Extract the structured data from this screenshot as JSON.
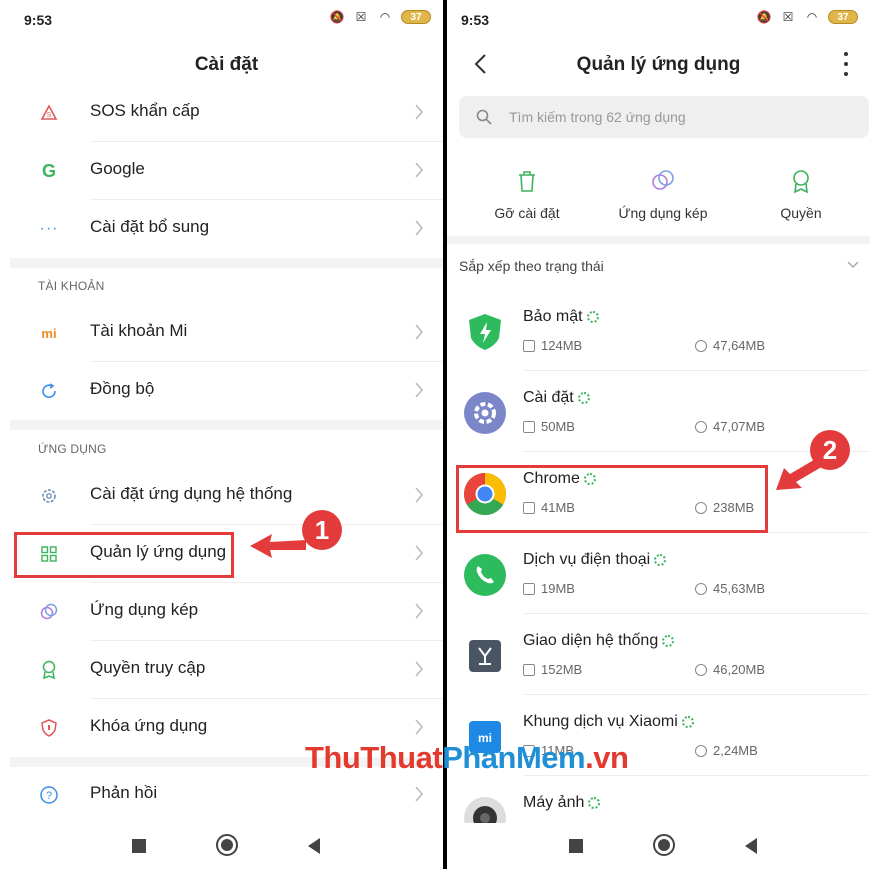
{
  "left": {
    "status": {
      "time": "9:53",
      "battery": "37"
    },
    "title": "Cài đặt",
    "rows_top": [
      {
        "label": "SOS khẩn cấp",
        "icon": "sos-icon"
      },
      {
        "label": "Google",
        "icon": "google-icon"
      },
      {
        "label": "Cài đặt bổ sung",
        "icon": "more-dots-icon"
      }
    ],
    "section_account": "TÀI KHOẢN",
    "rows_account": [
      {
        "label": "Tài khoản Mi",
        "icon": "mi-icon"
      },
      {
        "label": "Đồng bộ",
        "icon": "sync-icon"
      }
    ],
    "section_apps": "ỨNG DỤNG",
    "rows_apps": [
      {
        "label": "Cài đặt ứng dụng hệ thống",
        "icon": "gear-icon"
      },
      {
        "label": "Quản lý ứng dụng",
        "icon": "grid-icon"
      },
      {
        "label": "Ứng dụng kép",
        "icon": "dual-app-icon"
      },
      {
        "label": "Quyền truy cập",
        "icon": "permission-icon"
      },
      {
        "label": "Khóa ứng dụng",
        "icon": "shield-lock-icon"
      }
    ],
    "rows_bottom": [
      {
        "label": "Phản hồi",
        "icon": "help-icon"
      }
    ],
    "badge": "1"
  },
  "right": {
    "status": {
      "time": "9:53",
      "battery": "37"
    },
    "title": "Quản lý ứng dụng",
    "search_placeholder": "Tìm kiếm trong 62 ứng dụng",
    "actions": [
      {
        "label": "Gỡ cài đặt",
        "icon": "trash-icon"
      },
      {
        "label": "Ứng dụng kép",
        "icon": "dual-app-icon"
      },
      {
        "label": "Quyền",
        "icon": "permission-icon"
      }
    ],
    "sort_label": "Sắp xếp theo trạng thái",
    "apps": [
      {
        "name": "Bảo mật",
        "mem": "124MB",
        "size": "47,64MB",
        "icon": "security-shield-icon",
        "color": "#2dbb5e"
      },
      {
        "name": "Cài đặt",
        "mem": "50MB",
        "size": "47,07MB",
        "icon": "settings-gear-icon",
        "color": "#7b86c9"
      },
      {
        "name": "Chrome",
        "mem": "41MB",
        "size": "238MB",
        "icon": "chrome-icon",
        "color": "#e8453c"
      },
      {
        "name": "Dịch vụ điện thoại",
        "mem": "19MB",
        "size": "45,63MB",
        "icon": "phone-icon",
        "color": "#2dbb5e"
      },
      {
        "name": "Giao diện hệ thống",
        "mem": "152MB",
        "size": "46,20MB",
        "icon": "system-ui-icon",
        "color": "#4a5563"
      },
      {
        "name": "Khung dịch vụ Xiaomi",
        "mem": "11MB",
        "size": "2,24MB",
        "icon": "xiaomi-icon",
        "color": "#1e88e5"
      },
      {
        "name": "Máy ảnh",
        "mem": "",
        "size": "",
        "icon": "camera-icon",
        "color": "#888888"
      }
    ],
    "badge": "2"
  },
  "watermark": {
    "part_a": "ThuThuat",
    "part_b": "PhanMem",
    "part_c": ".vn"
  },
  "colors": {
    "highlight": "#e33b3b",
    "accent_green": "#3bb35a"
  }
}
